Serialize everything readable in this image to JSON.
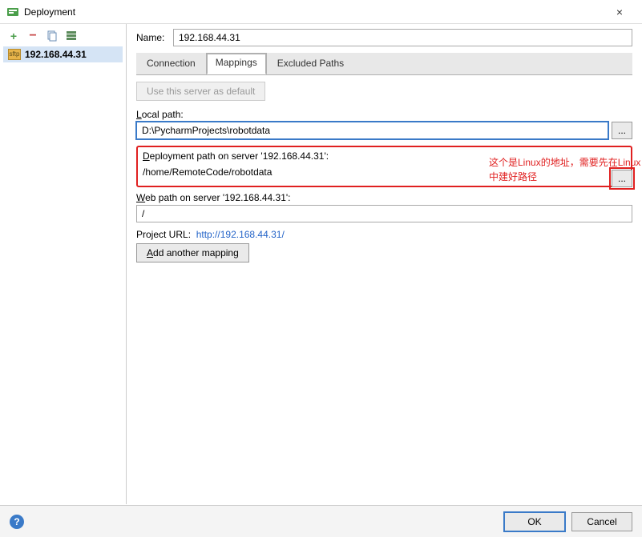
{
  "window": {
    "title": "Deployment"
  },
  "sidebar": {
    "servers": [
      {
        "name": "192.168.44.31"
      }
    ]
  },
  "main": {
    "name_label": "Name:",
    "name_value": "192.168.44.31",
    "tabs": {
      "connection": "Connection",
      "mappings": "Mappings",
      "excluded": "Excluded Paths"
    },
    "default_btn": "Use this server as default",
    "local_path_label": "Local path:",
    "local_path_value": "D:\\PycharmProjects\\robotdata",
    "deploy_path_label": "Deployment path on server '192.168.44.31':",
    "deploy_path_value": "/home/RemoteCode/robotdata",
    "web_path_label": "Web path on server '192.168.44.31':",
    "web_path_value": "/",
    "project_url_label": "Project URL:",
    "project_url_value": "http://192.168.44.31/",
    "add_mapping_btn": "Add another mapping",
    "browse": "..."
  },
  "annotation": {
    "line1": "这个是Linux的地址，需要先在Linux",
    "line2": "中建好路径"
  },
  "footer": {
    "ok": "OK",
    "cancel": "Cancel"
  }
}
